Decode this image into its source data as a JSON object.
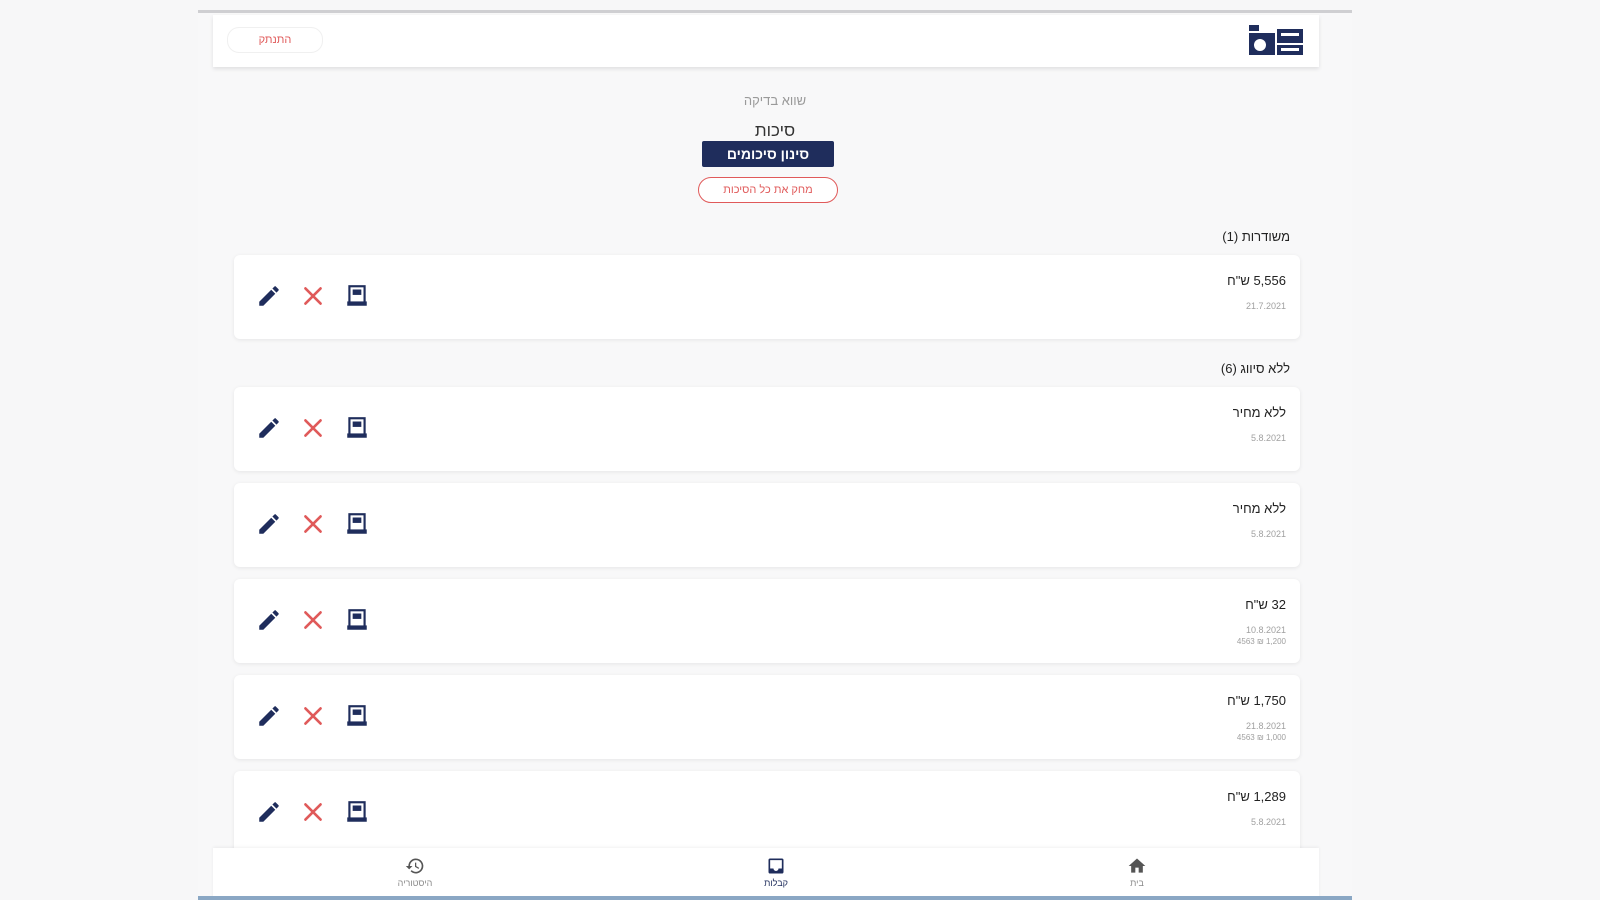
{
  "header": {
    "logout_label": "התנתק",
    "logo_alt": "logo"
  },
  "main": {
    "subtitle": "שווא בדיקה",
    "title": "סיכות",
    "filter_button": "סינון סיכומים",
    "clear_button": "מחק את כל הסיכות"
  },
  "sections": [
    {
      "label": "משודרות (1)",
      "items": [
        {
          "amount": "5,556 ש\"ח",
          "date": "21.7.2021",
          "note": ""
        }
      ]
    },
    {
      "label": "ללא סיווג (6)",
      "items": [
        {
          "amount": "ללא מחיר",
          "date": "5.8.2021",
          "note": ""
        },
        {
          "amount": "ללא מחיר",
          "date": "5.8.2021",
          "note": ""
        },
        {
          "amount": "32 ש\"ח",
          "date": "10.8.2021",
          "note": "1,200 ₪ 4563"
        },
        {
          "amount": "1,750 ש\"ח",
          "date": "21.8.2021",
          "note": "1,000 ₪ 4563"
        },
        {
          "amount": "1,289 ש\"ח",
          "date": "5.8.2021",
          "note": ""
        }
      ]
    }
  ],
  "bottom_nav": {
    "history": "היסטוריה",
    "inbox": "קבלות",
    "home": "בית"
  },
  "colors": {
    "brand": "#1f2d5c",
    "danger": "#e05a5a"
  }
}
